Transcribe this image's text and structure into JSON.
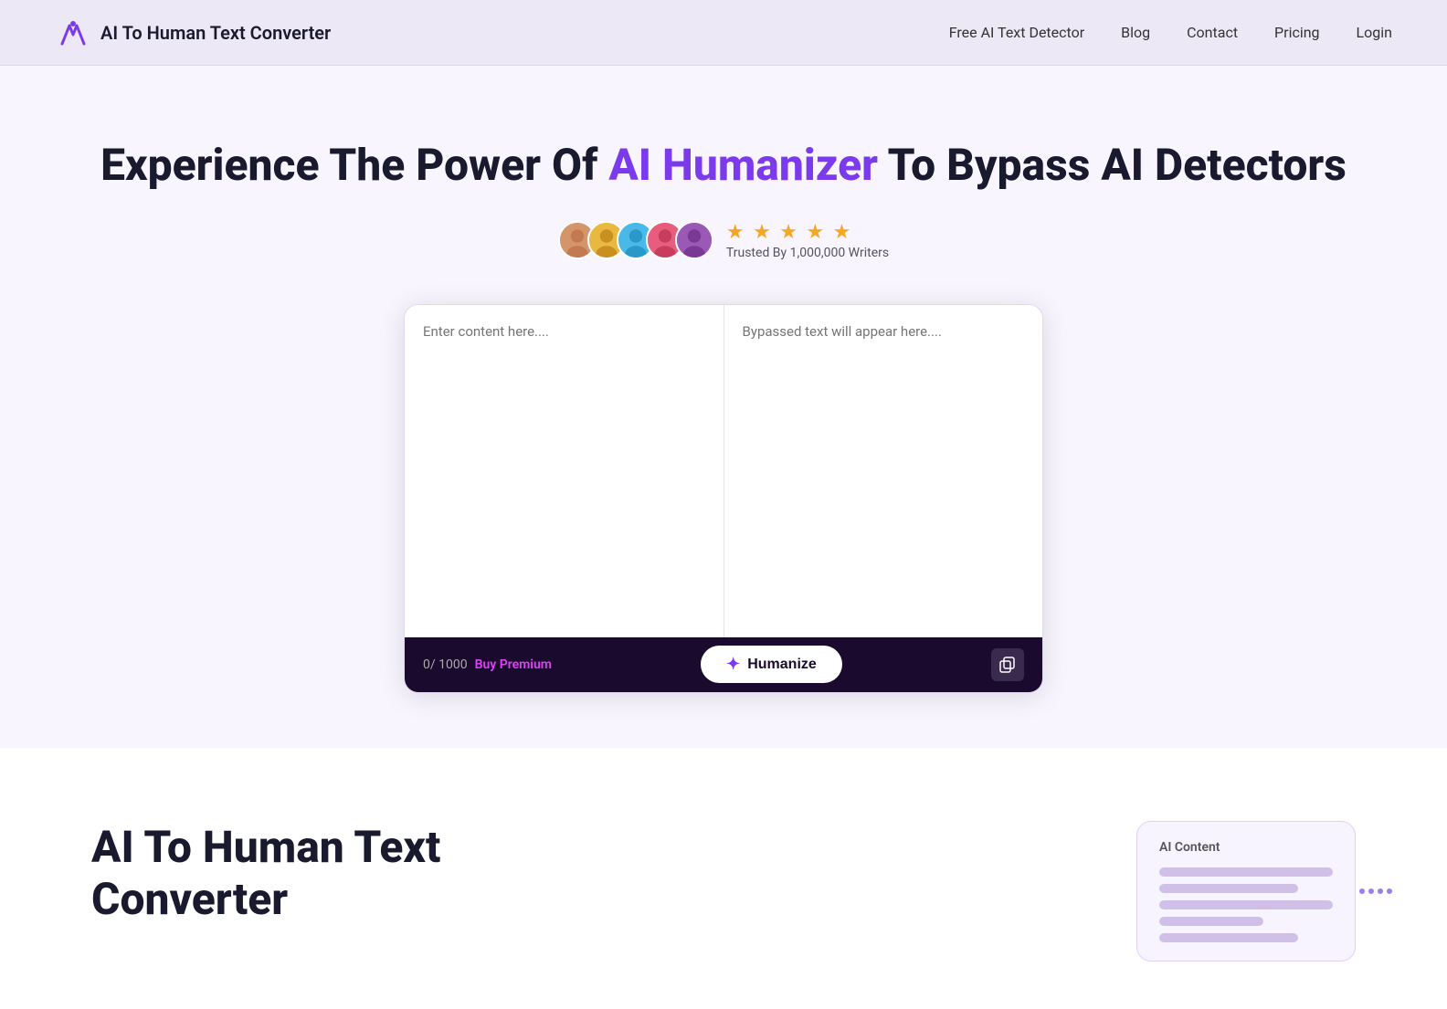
{
  "navbar": {
    "logo_text": "AI To Human Text Converter",
    "links": [
      {
        "id": "free-ai-detector",
        "label": "Free AI Text Detector"
      },
      {
        "id": "blog",
        "label": "Blog"
      },
      {
        "id": "contact",
        "label": "Contact"
      },
      {
        "id": "pricing",
        "label": "Pricing"
      },
      {
        "id": "login",
        "label": "Login"
      }
    ]
  },
  "hero": {
    "title_before": "Experience The Power Of ",
    "title_highlight": "AI Humanizer",
    "title_after": " To Bypass AI Detectors",
    "stars": "★ ★ ★ ★ ★",
    "trusted_text": "Trusted By 1,000,000 Writers",
    "avatars": [
      {
        "id": 1,
        "color": "#e8a87c"
      },
      {
        "id": 2,
        "color": "#f0c040"
      },
      {
        "id": 3,
        "color": "#5bc8f5"
      },
      {
        "id": 4,
        "color": "#e85d7e"
      },
      {
        "id": 5,
        "color": "#9b59b6"
      }
    ]
  },
  "tool": {
    "left_placeholder": "Enter content here....",
    "right_placeholder": "Bypassed text will appear here....",
    "word_count": "0/ 1000",
    "buy_premium_label": "Buy Premium",
    "humanize_button_label": "Humanize",
    "humanize_icon": "✦"
  },
  "bottom": {
    "title_line1": "AI To Human Text",
    "title_line2": "Converter",
    "card_label": "AI Content"
  },
  "colors": {
    "brand_purple": "#7c3aed",
    "dark_navy": "#1a0a2e",
    "light_purple_bg": "#ede8f5",
    "premium_pink": "#e040fb"
  }
}
